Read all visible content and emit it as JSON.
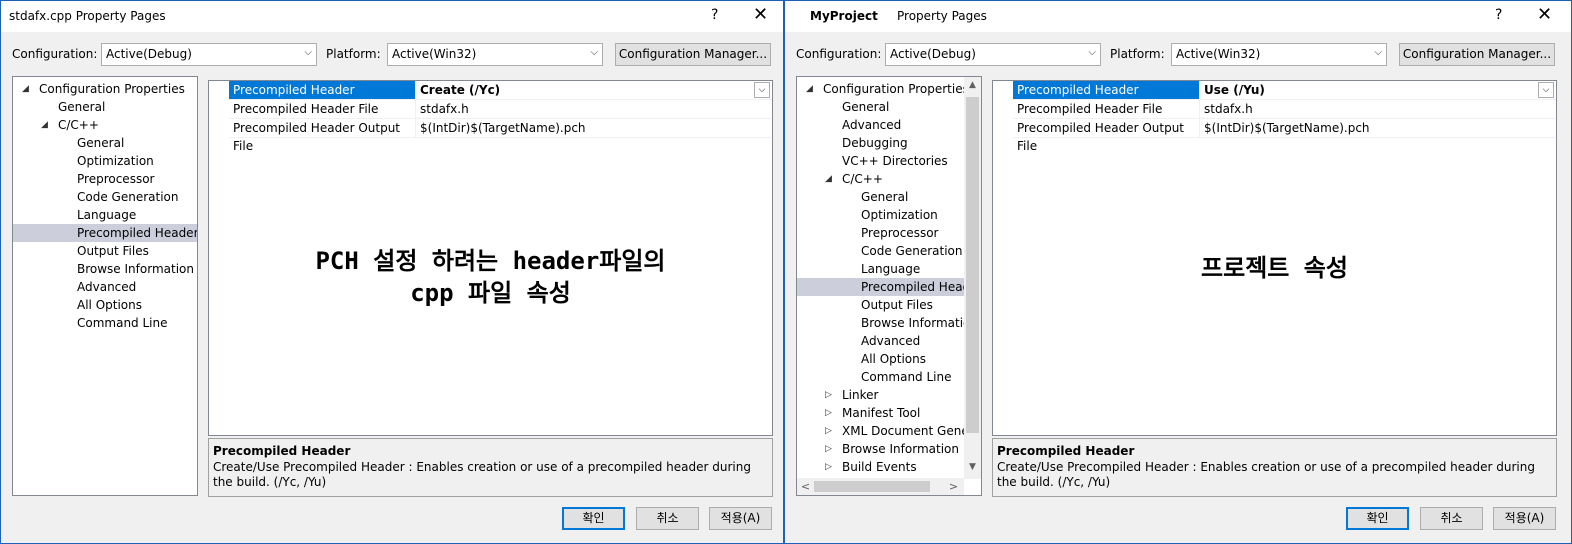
{
  "left": {
    "title": "stdafx.cpp Property Pages",
    "help": "?",
    "close": "✕",
    "configuration_label": "Configuration:",
    "configuration_value": "Active(Debug)",
    "platform_label": "Platform:",
    "platform_value": "Active(Win32)",
    "config_manager": "Configuration Manager...",
    "tree": [
      {
        "label": "Configuration Properties",
        "expander": "◢"
      },
      {
        "label": "General"
      },
      {
        "label": "C/C++",
        "expander": "◢"
      },
      {
        "label": "General"
      },
      {
        "label": "Optimization"
      },
      {
        "label": "Preprocessor"
      },
      {
        "label": "Code Generation"
      },
      {
        "label": "Language"
      },
      {
        "label": "Precompiled Headers",
        "selected": true
      },
      {
        "label": "Output Files"
      },
      {
        "label": "Browse Information"
      },
      {
        "label": "Advanced"
      },
      {
        "label": "All Options"
      },
      {
        "label": "Command Line"
      }
    ],
    "grid": [
      {
        "name": "Precompiled Header",
        "value": "Create (/Yc)"
      },
      {
        "name": "Precompiled Header File",
        "value": "stdafx.h"
      },
      {
        "name": "Precompiled Header Output File",
        "value": "$(IntDir)$(TargetName).pch"
      }
    ],
    "annotation_line1": "PCH 설정 하려는 header파일의",
    "annotation_line2": "cpp 파일 속성",
    "desc_title": "Precompiled Header",
    "desc_text": "Create/Use Precompiled Header : Enables creation or use of a precompiled header during the build. (/Yc, /Yu)",
    "ok": "확인",
    "cancel": "취소",
    "apply": "적용(A)"
  },
  "right": {
    "title_project": "MyProject",
    "title_sub": "Property Pages",
    "help": "?",
    "close": "✕",
    "configuration_label": "Configuration:",
    "configuration_value": "Active(Debug)",
    "platform_label": "Platform:",
    "platform_value": "Active(Win32)",
    "config_manager": "Configuration Manager...",
    "tree": [
      {
        "label": "Configuration Properties",
        "expander": "◢"
      },
      {
        "label": "General"
      },
      {
        "label": "Advanced"
      },
      {
        "label": "Debugging"
      },
      {
        "label": "VC++ Directories"
      },
      {
        "label": "C/C++",
        "expander": "◢"
      },
      {
        "label": "General"
      },
      {
        "label": "Optimization"
      },
      {
        "label": "Preprocessor"
      },
      {
        "label": "Code Generation"
      },
      {
        "label": "Language"
      },
      {
        "label": "Precompiled Heade",
        "selected": true
      },
      {
        "label": "Output Files"
      },
      {
        "label": "Browse Informatior"
      },
      {
        "label": "Advanced"
      },
      {
        "label": "All Options"
      },
      {
        "label": "Command Line"
      },
      {
        "label": "Linker",
        "expander": "▷"
      },
      {
        "label": "Manifest Tool",
        "expander": "▷"
      },
      {
        "label": "XML Document Genera",
        "expander": "▷"
      },
      {
        "label": "Browse Information",
        "expander": "▷"
      },
      {
        "label": "Build Events",
        "expander": "▷"
      }
    ],
    "grid": [
      {
        "name": "Precompiled Header",
        "value": "Use (/Yu)"
      },
      {
        "name": "Precompiled Header File",
        "value": "stdafx.h"
      },
      {
        "name": "Precompiled Header Output File",
        "value": "$(IntDir)$(TargetName).pch"
      }
    ],
    "annotation": "프로젝트 속성",
    "desc_title": "Precompiled Header",
    "desc_text": "Create/Use Precompiled Header : Enables creation or use of a precompiled header during the build. (/Yc, /Yu)",
    "ok": "확인",
    "cancel": "취소",
    "apply": "적용(A)"
  },
  "icons": {
    "dropdown": "⌵",
    "scroll_up": "▲",
    "scroll_down": "▼",
    "scroll_left": "<",
    "scroll_right": ">"
  }
}
